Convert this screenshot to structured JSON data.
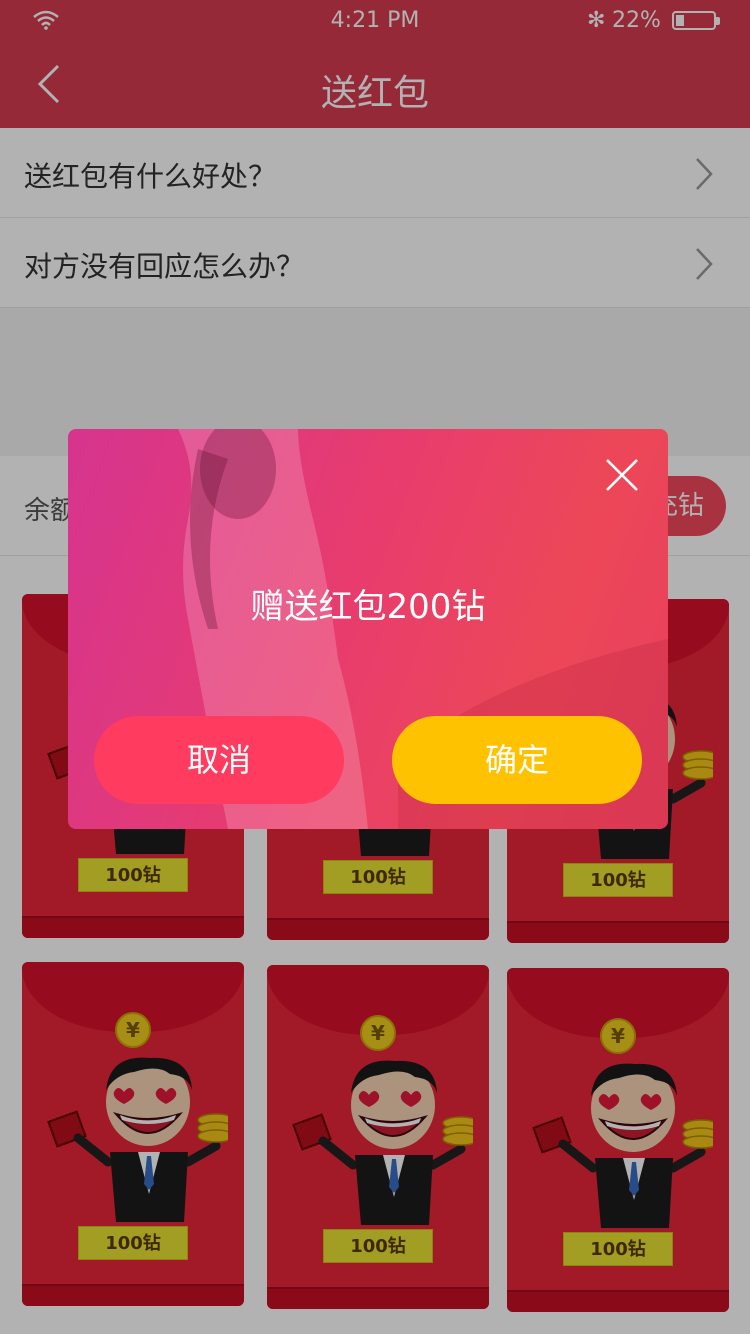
{
  "status_bar": {
    "time": "4:21 PM",
    "battery_percent": "22%",
    "bluetooth_glyph": "✻",
    "battery_level": 0.22
  },
  "nav": {
    "title": "送红包"
  },
  "faq": [
    {
      "label": "送红包有什么好处？"
    },
    {
      "label": "对方没有回应怎么办？"
    }
  ],
  "balance": {
    "label": "余额",
    "recharge_label": "充钻"
  },
  "envelopes": [
    {
      "coin": "¥",
      "amount": "100钻"
    },
    {
      "coin": "¥",
      "amount": "100钻"
    },
    {
      "coin": "¥",
      "amount": "100钻"
    },
    {
      "coin": "¥",
      "amount": "100钻"
    },
    {
      "coin": "¥",
      "amount": "100钻"
    },
    {
      "coin": "¥",
      "amount": "100钻"
    }
  ],
  "dialog": {
    "message": "赠送红包200钻",
    "cancel_label": "取消",
    "confirm_label": "确定"
  },
  "colors": {
    "brand": "#d73c50",
    "cancel": "#ff3b5f",
    "confirm": "#ffc200"
  }
}
